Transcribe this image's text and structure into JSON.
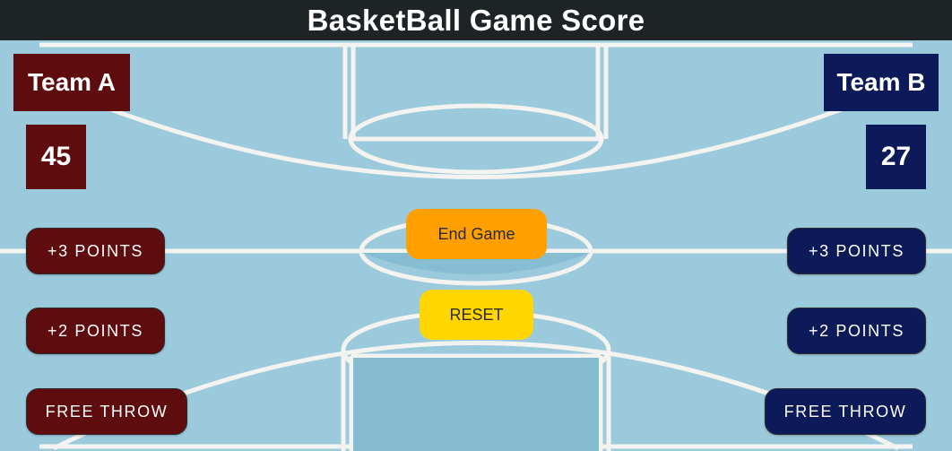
{
  "app": {
    "title": "BasketBall Game Score"
  },
  "team_a": {
    "name": "Team A",
    "score": "45",
    "buttons": {
      "three": "+3 POINTS",
      "two": "+2 POINTS",
      "free": "FREE THROW"
    }
  },
  "team_b": {
    "name": "Team B",
    "score": "27",
    "buttons": {
      "three": "+3 POINTS",
      "two": "+2 POINTS",
      "free": "FREE THROW"
    }
  },
  "controls": {
    "end_game": "End Game",
    "reset": "RESET"
  },
  "colors": {
    "team_a": "#5e0c0d",
    "team_b": "#0c1a5a",
    "end_game": "#ffa000",
    "reset": "#ffd600",
    "court": "#9ccadd",
    "app_bar": "#1e2326"
  }
}
